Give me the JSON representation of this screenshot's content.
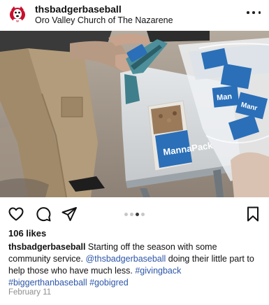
{
  "post": {
    "username": "thsbadgerbaseball",
    "location": "Oro Valley Church of The Nazarene",
    "likes": "106 likes",
    "caption": {
      "user": "thsbadgerbaseball",
      "text1": " Starting off the season with some community service. ",
      "mention": "@thsbadgerbaseball",
      "text2": " doing their little part to help those who have much less. ",
      "tags": [
        "#givingback",
        "#biggerthanbaseball",
        "#gobigred"
      ]
    },
    "date": "February 11"
  },
  "photo": {
    "package_label": "MannaPack"
  },
  "carousel": {
    "count": 4,
    "active_index": 2
  },
  "colors": {
    "link": "#2c56a8",
    "date": "#8e8e8e",
    "dot_active": "#3a3a3a",
    "dot_inactive": "#c7c7c7"
  },
  "icons": [
    "badger-logo-icon",
    "more-options-icon",
    "heart-icon",
    "comment-icon",
    "share-icon",
    "bookmark-icon"
  ]
}
